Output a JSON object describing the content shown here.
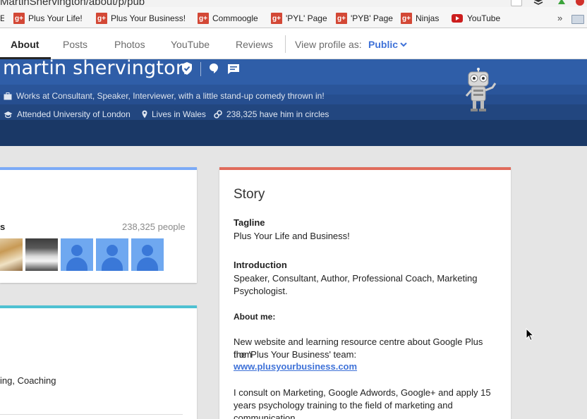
{
  "browser": {
    "url": "MartinShervington/about/p/pub",
    "bookmarks": [
      {
        "label": "Plus Your Life!",
        "icon": "google-plus-icon"
      },
      {
        "label": "Plus Your Business!",
        "icon": "google-plus-icon"
      },
      {
        "label": "Commoogle",
        "icon": "google-plus-icon"
      },
      {
        "label": "'PYL' Page",
        "icon": "google-plus-icon"
      },
      {
        "label": "'PYB' Page",
        "icon": "google-plus-icon"
      },
      {
        "label": "Ninjas",
        "icon": "google-plus-icon"
      },
      {
        "label": "YouTube",
        "icon": "youtube-icon"
      }
    ],
    "more_label": "»"
  },
  "nav": {
    "tabs": [
      "About",
      "Posts",
      "Photos",
      "YouTube",
      "Reviews"
    ],
    "active_tab": "About",
    "view_as_label": "View profile as:",
    "view_as_value": "Public"
  },
  "profile": {
    "name": "martin shervington",
    "work": "Works at Consultant, Speaker, Interviewer, with a little stand-up comedy thrown in!",
    "education": "Attended University of London",
    "location": "Lives in Wales",
    "circles": "238,325 have him in circles"
  },
  "circles_card": {
    "title": "s",
    "count": "238,325 people",
    "avatars": [
      "photo",
      "photo",
      "default-avatar",
      "default-avatar",
      "default-avatar"
    ]
  },
  "work_card": {
    "skills_fragment": "ing, Coaching"
  },
  "story": {
    "title": "Story",
    "tagline_label": "Tagline",
    "tagline": "Plus Your Life and Business!",
    "intro_label": "Introduction",
    "intro_line1": "Speaker, Consultant, Author, Professional Coach, Marketing",
    "intro_line2": "Psychologist.",
    "about_label": "About me:",
    "about_p1_line1": "New website and learning resource centre about Google Plus from",
    "about_p1_line2": "the 'Plus Your Business' team:",
    "about_link": "www.plusyourbusiness.com",
    "about_p2_line1": "I consult on Marketing, Google Adwords, Google+ and apply 15",
    "about_p2_line2": "years psychology training to the field of marketing and",
    "about_p2_line3": "communication"
  },
  "colors": {
    "header_blue": "#1e3d6e",
    "accent_blue": "#3f72d8",
    "story_accent": "#e06b5b",
    "circles_accent": "#7baaf7",
    "work_accent": "#4ec1d2"
  }
}
